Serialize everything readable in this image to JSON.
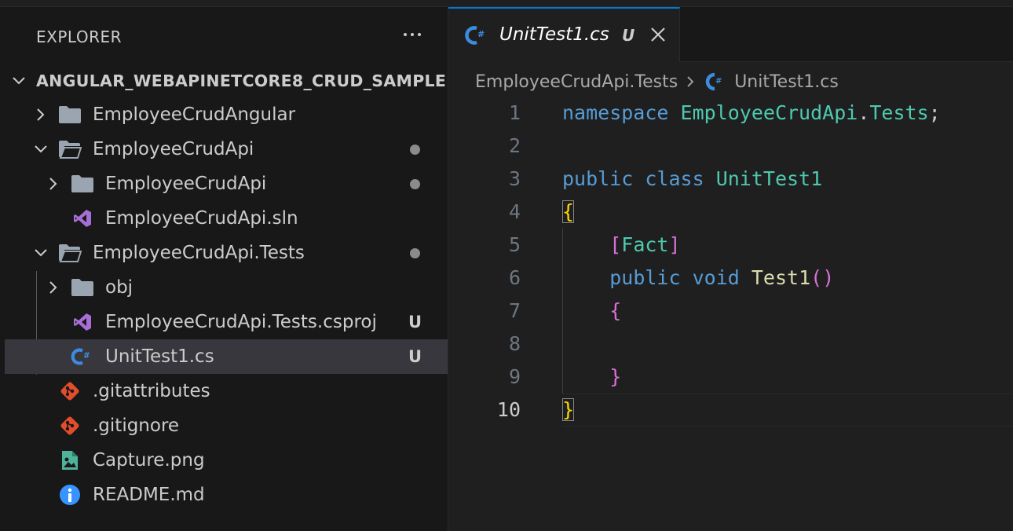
{
  "explorer": {
    "title": "EXPLORER",
    "root_label": "ANGULAR_WEBAPINETCORE8_CRUD_SAMPLE",
    "items": [
      {
        "label": "EmployeeCrudAngular",
        "type": "folder",
        "expanded": false
      },
      {
        "label": "EmployeeCrudApi",
        "type": "folder",
        "expanded": true,
        "modified": true
      },
      {
        "label": "EmployeeCrudApi",
        "type": "folder",
        "expanded": false,
        "modified": true
      },
      {
        "label": "EmployeeCrudApi.sln",
        "type": "visual-studio-file"
      },
      {
        "label": "EmployeeCrudApi.Tests",
        "type": "folder",
        "expanded": true,
        "modified": true
      },
      {
        "label": "obj",
        "type": "folder",
        "expanded": false
      },
      {
        "label": "EmployeeCrudApi.Tests.csproj",
        "type": "visual-studio-file",
        "status": "U"
      },
      {
        "label": "UnitTest1.cs",
        "type": "csharp-file",
        "status": "U",
        "selected": true
      },
      {
        "label": ".gitattributes",
        "type": "git-file"
      },
      {
        "label": ".gitignore",
        "type": "git-file"
      },
      {
        "label": "Capture.png",
        "type": "image-file"
      },
      {
        "label": "README.md",
        "type": "info-file"
      }
    ]
  },
  "editor": {
    "tab": {
      "label": "UnitTest1.cs",
      "status": "U"
    },
    "breadcrumb": {
      "folder": "EmployeeCrudApi.Tests",
      "file": "UnitTest1.cs"
    },
    "line_numbers": [
      "1",
      "2",
      "3",
      "4",
      "5",
      "6",
      "7",
      "8",
      "9",
      "10"
    ],
    "active_line": "10",
    "code": {
      "l1_kw": "namespace",
      "l1_ns1": "EmployeeCrudApi",
      "l1_dot": ".",
      "l1_ns2": "Tests",
      "l1_semi": ";",
      "l3_kw1": "public",
      "l3_kw2": "class",
      "l3_type": "UnitTest1",
      "l4_brace": "{",
      "l5_open": "[",
      "l5_attr": "Fact",
      "l5_close": "]",
      "l6_kw1": "public",
      "l6_kw2": "void",
      "l6_fn": "Test1",
      "l6_parens": "()",
      "l7_brace": "{",
      "l9_brace": "}",
      "l10_brace": "}"
    }
  },
  "colors": {
    "accent": "#0078d4",
    "keyword": "#569cd6",
    "type": "#4ec9b0",
    "function": "#dcdcaa",
    "bracket1": "#ffd700",
    "bracket2": "#da70d6",
    "bracket3": "#179fff",
    "csharp_icon": "#3c8ce0",
    "visual_studio_icon": "#a66fd6",
    "git_icon": "#e44d2b",
    "image_icon": "#4fb39a",
    "info_icon": "#3794ff"
  }
}
